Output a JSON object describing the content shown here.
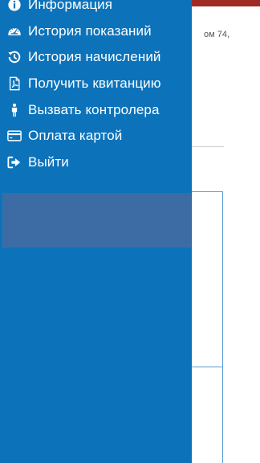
{
  "background": {
    "partial_text": "ом 74,"
  },
  "drawer": {
    "items": [
      {
        "label": "Информация",
        "icon": "info-icon"
      },
      {
        "label": "История показаний",
        "icon": "gauge-icon"
      },
      {
        "label": "История начислений",
        "icon": "history-icon"
      },
      {
        "label": "Получить квитанцию",
        "icon": "pdf-icon"
      },
      {
        "label": "Вызвать контролера",
        "icon": "person-icon"
      },
      {
        "label": "Оплата картой",
        "icon": "credit-card-icon"
      },
      {
        "label": "Выйти",
        "icon": "sign-out-icon"
      }
    ]
  },
  "colors": {
    "drawer_bg": "#0c73bb",
    "topbar": "#9e2b25",
    "highlight": "#3d6ca4"
  }
}
